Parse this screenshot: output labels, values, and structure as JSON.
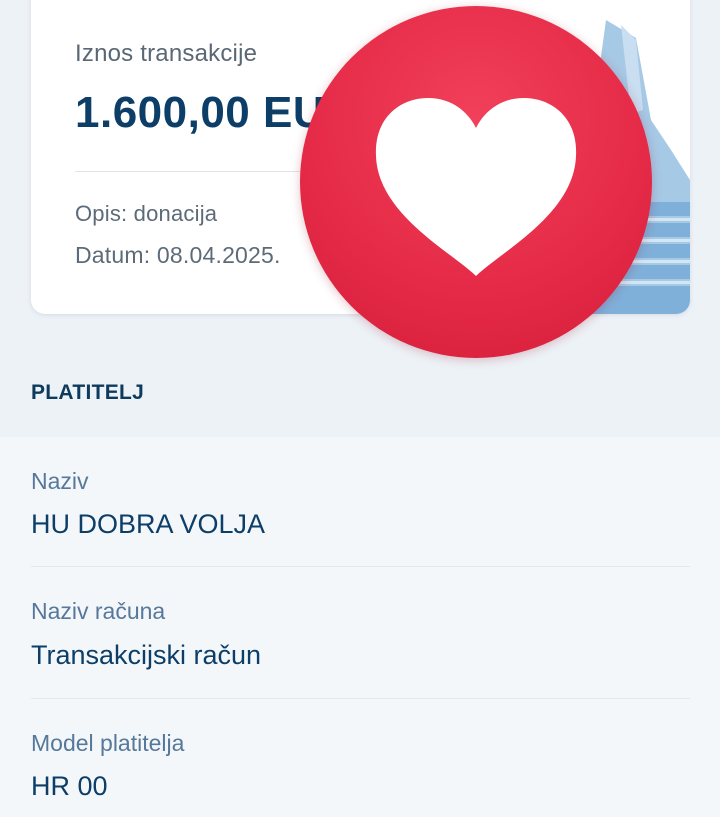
{
  "transaction_card": {
    "amount_label": "Iznos transakcije",
    "amount_value": "1.600,00 EUR",
    "description": "Opis: donacija",
    "date": "Datum: 08.04.2025."
  },
  "overlay": {
    "icon": "heart-icon",
    "badge_color": "#e52b47"
  },
  "payer_section": {
    "title": "PLATITELJ",
    "fields": [
      {
        "label": "Naziv",
        "value": "HU DOBRA VOLJA"
      },
      {
        "label": "Naziv računa",
        "value": "Transakcijski račun"
      },
      {
        "label": "Model platitelja",
        "value": "HR 00"
      }
    ]
  },
  "colors": {
    "primary_text": "#0c3e68",
    "label_text": "#56789a",
    "deco_blue": "#9cc3e2"
  }
}
